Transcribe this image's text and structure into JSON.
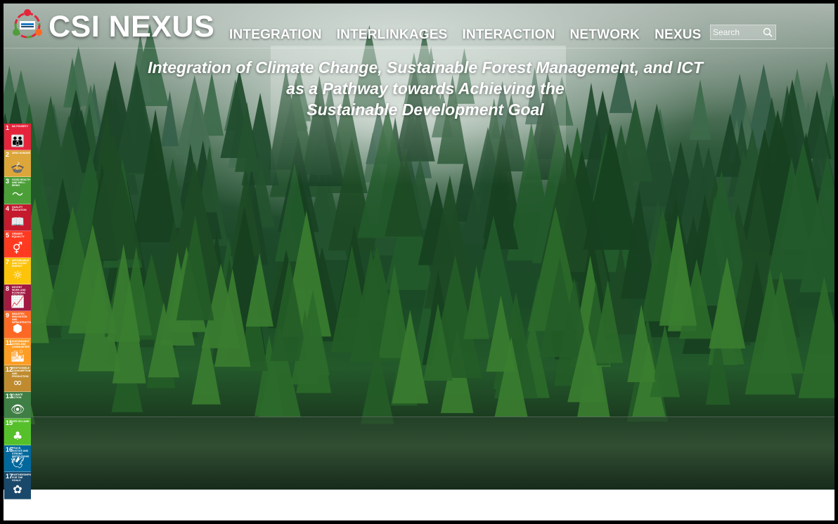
{
  "brand": {
    "name": "CSI NEXUS",
    "logo_icon": "sdg-wheel-logo-icon"
  },
  "nav": {
    "items": [
      {
        "label": "INTEGRATION"
      },
      {
        "label": "INTERLINKAGES"
      },
      {
        "label": "INTERACTION"
      },
      {
        "label": "NETWORK"
      },
      {
        "label": "NEXUS"
      }
    ]
  },
  "search": {
    "placeholder": "Search",
    "value": "",
    "icon": "search-icon"
  },
  "hero": {
    "tagline_line1": "Integration of Climate Change, Sustainable Forest Management, and ICT",
    "tagline_line2": "as a Pathway towards Achieving the",
    "tagline_line3": "Sustainable Development Goal"
  },
  "sdg_goals": [
    {
      "num": "1",
      "label": "No poverty",
      "color": "#e5243b",
      "icon": "family-icon",
      "glyph": "👪"
    },
    {
      "num": "2",
      "label": "Zero hunger",
      "color": "#dda63a",
      "icon": "bowl-icon",
      "glyph": "🍲"
    },
    {
      "num": "3",
      "label": "Good health and well-being",
      "color": "#4c9f38",
      "icon": "heartbeat-icon",
      "glyph": "〜"
    },
    {
      "num": "4",
      "label": "Quality education",
      "color": "#c5192d",
      "icon": "book-icon",
      "glyph": "📖"
    },
    {
      "num": "5",
      "label": "Gender equality",
      "color": "#ff3a21",
      "icon": "gender-icon",
      "glyph": "⚥"
    },
    {
      "num": "7",
      "label": "Affordable and clean energy",
      "color": "#fcc30b",
      "icon": "sun-icon",
      "glyph": "☼"
    },
    {
      "num": "8",
      "label": "Decent work and economic growth",
      "color": "#a21942",
      "icon": "growth-chart-icon",
      "glyph": "📈"
    },
    {
      "num": "9",
      "label": "Industry, innovation and infrastructure",
      "color": "#fd6925",
      "icon": "cubes-icon",
      "glyph": "⬢"
    },
    {
      "num": "11",
      "label": "Sustainable cities and communities",
      "color": "#fd9d24",
      "icon": "buildings-icon",
      "glyph": "🏙"
    },
    {
      "num": "12",
      "label": "Responsible consumption and production",
      "color": "#bf8b2e",
      "icon": "infinity-icon",
      "glyph": "∞"
    },
    {
      "num": "13",
      "label": "Climate action",
      "color": "#3f7e44",
      "icon": "eye-icon",
      "glyph": "👁"
    },
    {
      "num": "15",
      "label": "Life on land",
      "color": "#56c02b",
      "icon": "tree-bird-icon",
      "glyph": "♣"
    },
    {
      "num": "16",
      "label": "Peace, justice and strong institutions",
      "color": "#00689d",
      "icon": "dove-icon",
      "glyph": "🕊"
    },
    {
      "num": "17",
      "label": "Partnerships for the goals",
      "color": "#19486a",
      "icon": "flower-rings-icon",
      "glyph": "✿"
    }
  ]
}
